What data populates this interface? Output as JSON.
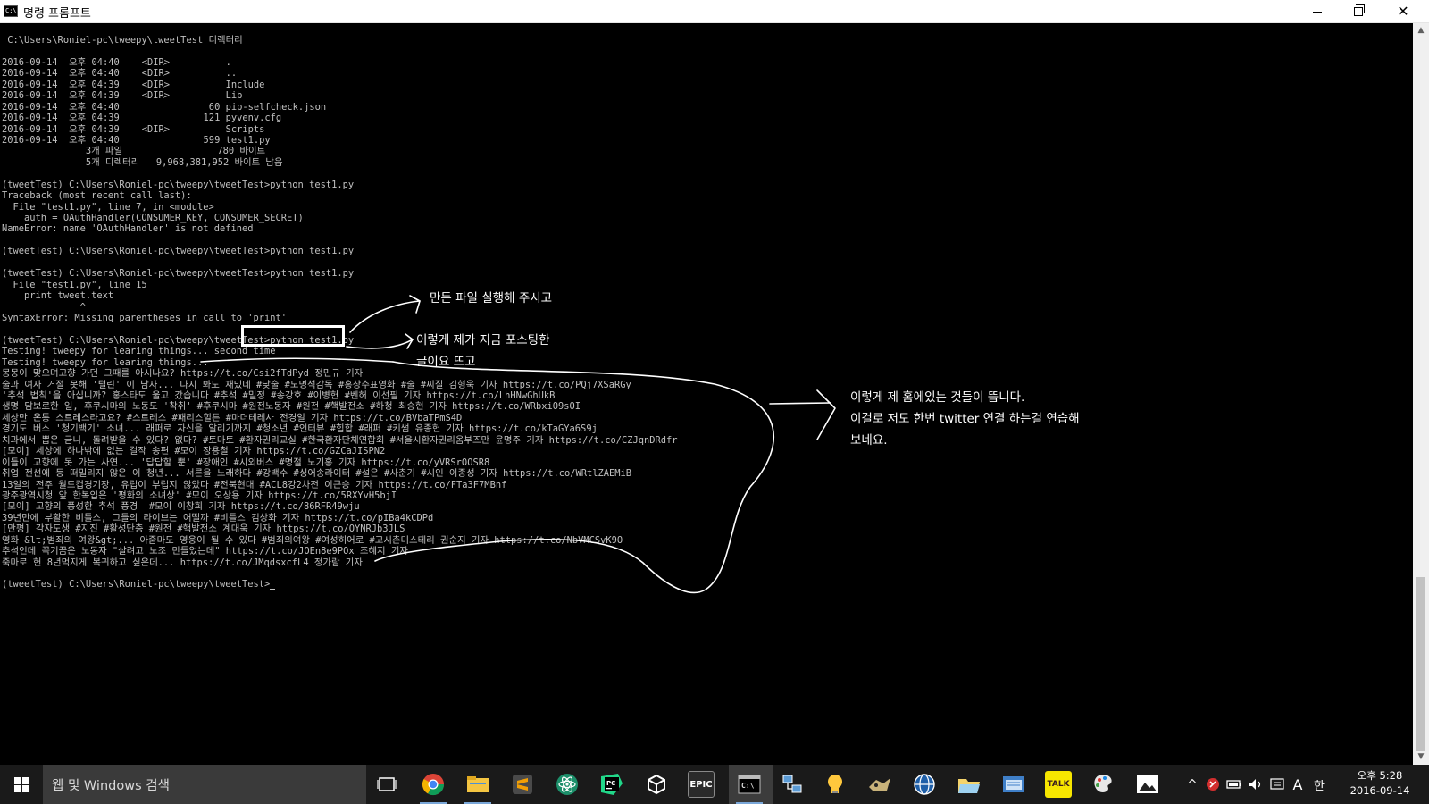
{
  "window": {
    "title": "명령 프롬프트",
    "icon_text": "C:\\"
  },
  "console": {
    "lines": [
      " C:\\Users\\Roniel-pc\\tweepy\\tweetTest 디렉터리",
      "",
      "2016-09-14  오후 04:40    <DIR>          .",
      "2016-09-14  오후 04:40    <DIR>          ..",
      "2016-09-14  오후 04:39    <DIR>          Include",
      "2016-09-14  오후 04:39    <DIR>          Lib",
      "2016-09-14  오후 04:40                60 pip-selfcheck.json",
      "2016-09-14  오후 04:39               121 pyvenv.cfg",
      "2016-09-14  오후 04:39    <DIR>          Scripts",
      "2016-09-14  오후 04:40               599 test1.py",
      "               3개 파일                 780 바이트",
      "               5개 디렉터리   9,968,381,952 바이트 남음",
      "",
      "(tweetTest) C:\\Users\\Roniel-pc\\tweepy\\tweetTest>python test1.py",
      "Traceback (most recent call last):",
      "  File \"test1.py\", line 7, in <module>",
      "    auth = OAuthHandler(CONSUMER_KEY, CONSUMER_SECRET)",
      "NameError: name 'OAuthHandler' is not defined",
      "",
      "(tweetTest) C:\\Users\\Roniel-pc\\tweepy\\tweetTest>python test1.py",
      "",
      "(tweetTest) C:\\Users\\Roniel-pc\\tweepy\\tweetTest>python test1.py",
      "  File \"test1.py\", line 15",
      "    print tweet.text",
      "              ^",
      "SyntaxError: Missing parentheses in call to 'print'",
      "",
      "(tweetTest) C:\\Users\\Roniel-pc\\tweepy\\tweetTest>python test1.py",
      "Testing! tweepy for learing things... second time",
      "Testing! tweepy for learing things...",
      "몽몽이 맞으며고향 가던 그때를 아시나요? https://t.co/Csi2fTdPyd 정민규 기자",
      "술과 여자 거절 못해 '털린' 이 남자... 다시 봐도 재밌네 #낮술 #노명석감독 #홍상수표영화 #술 #찌질 김형욱 기자 https://t.co/PQj7XSaRGy",
      "'추석 법칙'을 아십니까? 홍스타도 울고 갔습니다 #추석 #밀정 #송강호 #이병헌 #벤허 이선필 기자 https://t.co/LhHNwGhUkB",
      "생명 담보로한 일, 후쿠시마의 노동도 '착취' #후쿠시마 #원전노동자 #원전 #핵발전소 #하청 최승현 기자 https://t.co/WRbxiO9sOI",
      "세상만 온통 스트레스라고요? #스트레스 #패리스힐튼 #마더테레사 전경일 기자 https://t.co/BVbaTPmS4D",
      "경기도 버스 '청기백기' 소녀... 래퍼로 자신을 알리기까지 #청소년 #인터뷰 #힙합 #래퍼 #키썸 유종헌 기자 https://t.co/kTaGYa6S9j",
      "치과에서 뽑은 금니, 돌려받을 수 있다? 없다? #토마토 #환자권리교실 #한국환자단체연합회 #서울시환자권리옴부즈만 윤명주 기자 https://t.co/CZJqnDRdfr",
      "[모이] 세상에 하나밖에 없는 걸작 송편 #모이 장용철 기자 https://t.co/GZCaJISPN2",
      "이들이 고향에 못 가는 사연... '답답할 뿐' #장애인 #시외버스 #명절 노기홍 기자 https://t.co/yVRSrOOSR8",
      "취업 전선에 등 떠밀리지 않은 이 청년... 서른을 노래하다 #강백수 #싱어송라이터 #설은 #사춘기 #시인 이종성 기자 https://t.co/WRtlZAEMiB",
      "13일의 전주 월드컵경기장, 유럽이 부럽지 않았다 #전북현대 #ACL8강2차전 이근승 기자 https://t.co/FTa3F7MBnf",
      "광주광역시청 앞 한복입은 '평화의 소녀상' #모이 오상용 기자 https://t.co/5RXYvH5bjI",
      "[모이] 고향의 풍성한 추석 풍경  #모이 이창희 기자 https://t.co/86RFR49wju",
      "39년만에 부활한 비틀스, 그들의 라이브는 어떨까 #비틀스 김상화 기자 https://t.co/pIBa4kCDPd",
      "[만평] 각자도생 #지진 #활성단층 #원전 #핵발전소 계대욱 기자 https://t.co/OYNRJb3JLS",
      "영화 &lt;범죄의 여왕&gt;... 아줌마도 영웅이 될 수 있다 #범죄의여왕 #여성히어로 #고시촌미스테리 권순지 기자 https://t.co/NbVMCSvK9O",
      "추석인데 꼭기꿈은 노동자 \"살려고 노조 만들었는데\" https://t.co/JOEn8e9POx 조혜지 기자",
      "죽마로 헌 8년먹지게 복귀하고 싶은데... https://t.co/JMqdsxcfL4 정가람 기자",
      "",
      "(tweetTest) C:\\Users\\Roniel-pc\\tweepy\\tweetTest>"
    ]
  },
  "annotations": {
    "note1": "만든 파일 실행해 주시고",
    "note2": "이렇게 제가 지금 포스팅한\n글이요 뜨고",
    "note3": "이렇게 제 홈에있는 것들이 뜹니다.\n이걸로 저도 한번 twitter 연결 하는걸 연습해\n보네요."
  },
  "taskbar": {
    "search_placeholder": "웹 및 Windows 검색",
    "pinned": [
      {
        "name": "task-view-icon"
      },
      {
        "name": "chrome-icon"
      },
      {
        "name": "file-explorer-icon"
      },
      {
        "name": "sublime-text-icon"
      },
      {
        "name": "atom-icon"
      },
      {
        "name": "pycharm-icon"
      },
      {
        "name": "unity-icon"
      },
      {
        "name": "epic-games-icon",
        "label": "EPIC"
      },
      {
        "name": "command-prompt-icon"
      },
      {
        "name": "network-icon"
      },
      {
        "name": "lightbulb-icon"
      },
      {
        "name": "game-icon"
      },
      {
        "name": "globe-icon"
      },
      {
        "name": "folder-app-icon"
      },
      {
        "name": "notepad-icon"
      },
      {
        "name": "kakaotalk-icon",
        "label": "TALK"
      },
      {
        "name": "paint-icon"
      },
      {
        "name": "photos-icon"
      }
    ],
    "tray": {
      "chevron": "^",
      "ime_letter": "A",
      "ime_lang": "한"
    },
    "clock": {
      "time": "오후 5:28",
      "date": "2016-09-14"
    }
  },
  "colors": {
    "console_bg": "#000000",
    "console_fg": "#c0c0c0",
    "annotation": "#ffffff",
    "taskbar_bg": "#1a1a1a",
    "epic": "#2a2a2a",
    "kakao": "#f7e600",
    "chrome_red": "#db4437",
    "explorer": "#f4c542"
  }
}
